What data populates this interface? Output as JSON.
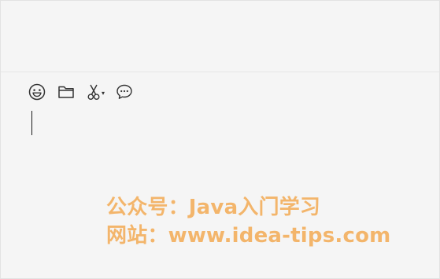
{
  "toolbar": {
    "items": [
      {
        "icon": "smiley-icon",
        "label": ""
      },
      {
        "icon": "folder-icon",
        "label": ""
      },
      {
        "icon": "scissors-icon",
        "label": "▾"
      },
      {
        "icon": "chat-bubble-icon",
        "label": ""
      }
    ]
  },
  "input": {
    "value": ""
  },
  "watermark": {
    "line1": "公众号：Java入门学习",
    "line2": "网站：www.idea-tips.com",
    "color": "#f3b56b"
  }
}
